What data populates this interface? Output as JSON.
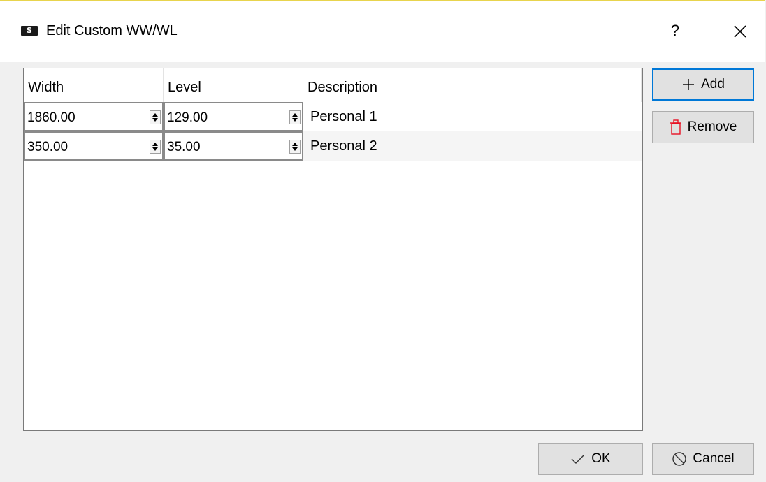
{
  "window": {
    "title": "Edit Custom WW/WL",
    "app_icon_letter": "S",
    "help_label": "?",
    "close_icon": "close-icon"
  },
  "table": {
    "columns": [
      "Width",
      "Level",
      "Description"
    ],
    "rows": [
      {
        "width": "1860.00",
        "level": "129.00",
        "description": "Personal 1"
      },
      {
        "width": "350.00",
        "level": "35.00",
        "description": "Personal 2"
      }
    ]
  },
  "side_buttons": {
    "add_label": "Add",
    "remove_label": "Remove"
  },
  "footer": {
    "ok_label": "OK",
    "cancel_label": "Cancel"
  },
  "colors": {
    "accent": "#0078d7",
    "remove_icon": "#e81123",
    "title_border": "#e8d44d"
  }
}
